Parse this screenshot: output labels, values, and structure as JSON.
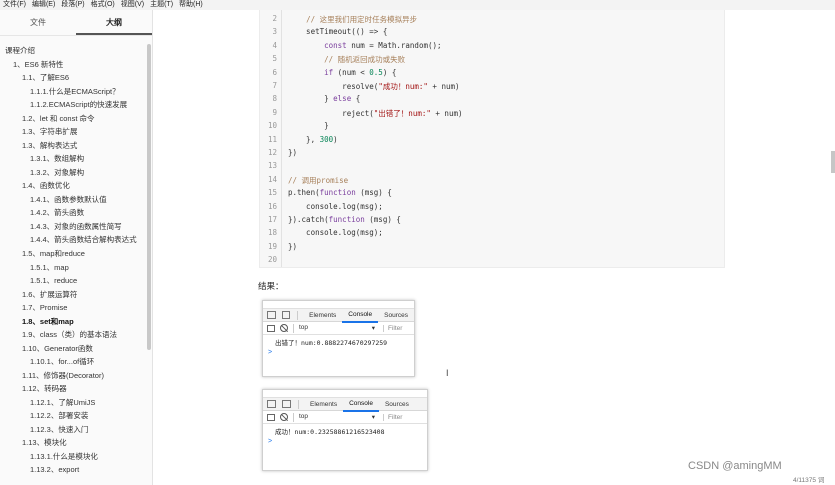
{
  "menu": [
    "文件(F)",
    "编辑(E)",
    "段落(P)",
    "格式(O)",
    "视图(V)",
    "主题(T)",
    "帮助(H)"
  ],
  "sidebar": {
    "tabs": [
      {
        "label": "文件",
        "active": false
      },
      {
        "label": "大纲",
        "active": true
      }
    ],
    "outline": [
      {
        "label": "课程介绍",
        "level": 0
      },
      {
        "label": "1、ES6 新特性",
        "level": 1
      },
      {
        "label": "1.1、了解ES6",
        "level": 2
      },
      {
        "label": "1.1.1.什么是ECMAScript？",
        "level": 3
      },
      {
        "label": "1.1.2.ECMAScript的快速发展",
        "level": 3
      },
      {
        "label": "1.2、let 和 const 命令",
        "level": 2
      },
      {
        "label": "1.3、字符串扩展",
        "level": 2
      },
      {
        "label": "1.3、解构表达式",
        "level": 2
      },
      {
        "label": "1.3.1、数组解构",
        "level": 3
      },
      {
        "label": "1.3.2、对象解构",
        "level": 3
      },
      {
        "label": "1.4、函数优化",
        "level": 2
      },
      {
        "label": "1.4.1、函数参数默认值",
        "level": 3
      },
      {
        "label": "1.4.2、箭头函数",
        "level": 3
      },
      {
        "label": "1.4.3、对象的函数属性简写",
        "level": 3
      },
      {
        "label": "1.4.4、箭头函数结合解构表达式",
        "level": 3,
        "wrap": true
      },
      {
        "label": "1.5、map和reduce",
        "level": 2
      },
      {
        "label": "1.5.1、map",
        "level": 3
      },
      {
        "label": "1.5.1、reduce",
        "level": 3
      },
      {
        "label": "1.6、扩展运算符",
        "level": 2
      },
      {
        "label": "1.7、Promise",
        "level": 2
      },
      {
        "label": "1.8、set和map",
        "level": 2,
        "active": true
      },
      {
        "label": "1.9、class（类）的基本语法",
        "level": 2
      },
      {
        "label": "1.10、Generator函数",
        "level": 2
      },
      {
        "label": "1.10.1、for...of循环",
        "level": 3
      },
      {
        "label": "1.11、修饰器(Decorator)",
        "level": 2
      },
      {
        "label": "1.12、转码器",
        "level": 2
      },
      {
        "label": "1.12.1、了解UmiJS",
        "level": 3
      },
      {
        "label": "1.12.2、部署安装",
        "level": 3
      },
      {
        "label": "1.12.3、快速入门",
        "level": 3
      },
      {
        "label": "1.13、模块化",
        "level": 2
      },
      {
        "label": "1.13.1.什么是模块化",
        "level": 3
      },
      {
        "label": "1.13.2、export",
        "level": 3
      }
    ],
    "footer": {
      "left": "<",
      "right": "</>"
    }
  },
  "code": {
    "lines": [
      {
        "n": "2",
        "html": "    <span class='c-cm'>// 这里我们用定时任务模拟异步</span>"
      },
      {
        "n": "3",
        "html": "    setTimeout(() => {"
      },
      {
        "n": "4",
        "html": "        <span class='c-kw'>const</span> num = Math.random();"
      },
      {
        "n": "5",
        "html": "        <span class='c-cm'>// 随机返回成功或失败</span>"
      },
      {
        "n": "6",
        "html": "        <span class='c-kw'>if</span> (num < <span class='c-num'>0.5</span>) {"
      },
      {
        "n": "7",
        "html": "            resolve(<span class='c-str'>\"成功！num:\"</span> + num)"
      },
      {
        "n": "8",
        "html": "        } <span class='c-kw'>else</span> {"
      },
      {
        "n": "9",
        "html": "            reject(<span class='c-str'>\"出错了！num:\"</span> + num)"
      },
      {
        "n": "10",
        "html": "        }"
      },
      {
        "n": "11",
        "html": "    }, <span class='c-num'>300</span>)"
      },
      {
        "n": "12",
        "html": "})"
      },
      {
        "n": "13",
        "html": ""
      },
      {
        "n": "14",
        "html": "<span class='c-cm'>// 调用promise</span>"
      },
      {
        "n": "15",
        "html": "p.then(<span class='c-kw'>function</span> (msg) {"
      },
      {
        "n": "16",
        "html": "    console.log(msg);"
      },
      {
        "n": "17",
        "html": "}).catch(<span class='c-kw'>function</span> (msg) {"
      },
      {
        "n": "18",
        "html": "    console.log(msg);"
      },
      {
        "n": "19",
        "html": "})"
      },
      {
        "n": "20",
        "html": ""
      }
    ]
  },
  "result_label": "结果：",
  "devtools": [
    {
      "tabs": [
        "Elements",
        "Console",
        "Sources"
      ],
      "active_tab": "Console",
      "context": "top",
      "filter_placeholder": "Filter",
      "output": "出错了！num:0.8882274670297259",
      "prompt": ">"
    },
    {
      "tabs": [
        "Elements",
        "Console",
        "Sources"
      ],
      "active_tab": "Console",
      "context": "top",
      "filter_placeholder": "Filter",
      "output": "成功！num:0.23258861216523408",
      "prompt": ">"
    }
  ],
  "status": {
    "watermark": "CSDN @amingMM",
    "word_count": "4/11375 词"
  }
}
